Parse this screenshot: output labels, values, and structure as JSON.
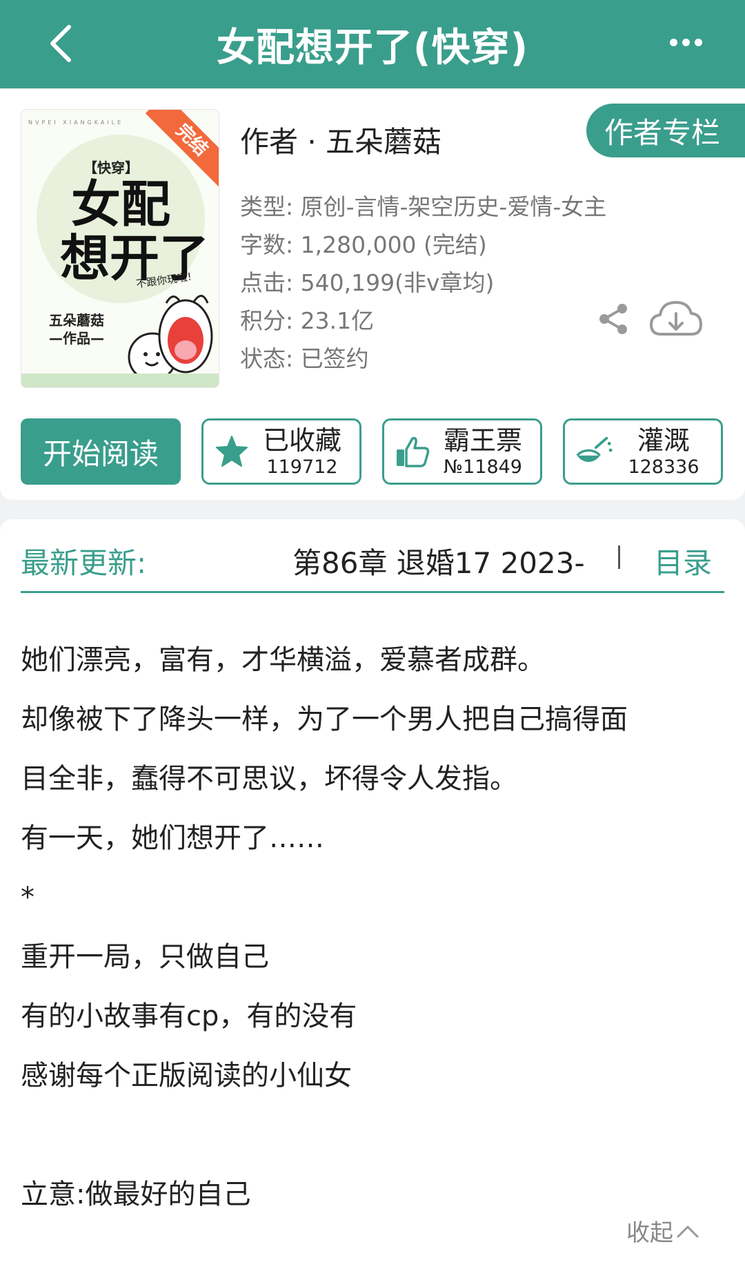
{
  "header": {
    "title": "女配想开了(快穿)"
  },
  "cover": {
    "ribbon": "完结",
    "top_line": "NVPEI XIANGKAILE",
    "tag": "【快穿】",
    "title_line1": "女配",
    "title_line2": "想开了",
    "slogan": "不跟你玩啦!",
    "author_line1": "五朵蘑菇",
    "author_line2": "—作品—"
  },
  "book": {
    "author_line": "作者 · 五朵蘑菇",
    "author_column_label": "作者专栏",
    "type": "类型: 原创-言情-架空历史-爱情-女主",
    "word_count": "字数: 1,280,000 (完结)",
    "clicks": "点击: 540,199(非v章均)",
    "score": "积分: 23.1亿",
    "status": "状态: 已签约"
  },
  "actions": {
    "read_label": "开始阅读",
    "favorite": {
      "label": "已收藏",
      "count": "119712"
    },
    "vote": {
      "label": "霸王票",
      "count": "№11849"
    },
    "water": {
      "label": "灌溉",
      "count": "128336"
    }
  },
  "update": {
    "label": "最新更新:",
    "text": "第86章  退婚17  2023-",
    "toc_label": "目录"
  },
  "description": {
    "lines": [
      "她们漂亮，富有，才华横溢，爱慕者成群。",
      "却像被下了降头一样，为了一个男人把自己搞得面",
      "目全非，蠢得不可思议，坏得令人发指。",
      "有一天，她们想开了……",
      "*",
      "重开一局，只做自己",
      "有的小故事有cp，有的没有",
      "感谢每个正版阅读的小仙女",
      "",
      "立意:做最好的自己"
    ],
    "collapse_label": "收起"
  },
  "colors": {
    "primary": "#3a9e8c",
    "ribbon": "#f2693b"
  }
}
